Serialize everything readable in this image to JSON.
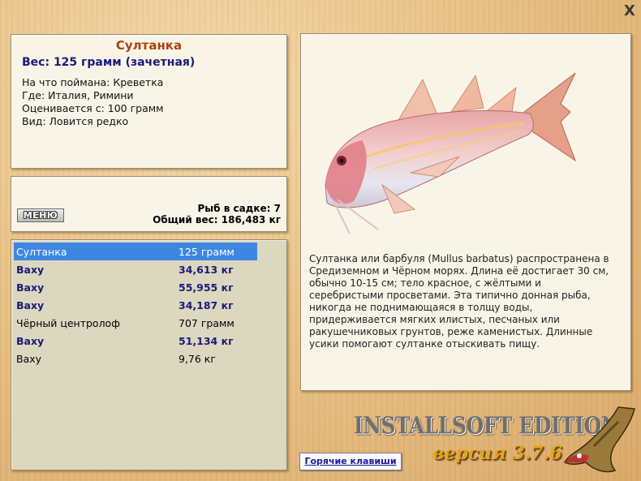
{
  "window": {
    "close_label": "X"
  },
  "info": {
    "name": "Султанка",
    "weight": "Вес: 125 грамм (зачетная)",
    "bait": "На что поймана: Креветка",
    "place": "Где: Италия, Римини",
    "valued": "Оценивается с: 100 грамм",
    "kind": "Вид: Ловится редко"
  },
  "stats": {
    "menu_label": "МЕНЮ",
    "fish_count": "Рыб в садке: 7",
    "total_weight": "Общий вес: 186,483 кг"
  },
  "catch_list": [
    {
      "name": "Султанка",
      "weight": "125 грамм",
      "style": "selected"
    },
    {
      "name": "Ваху",
      "weight": "34,613 кг",
      "style": "bold"
    },
    {
      "name": "Ваху",
      "weight": "55,955 кг",
      "style": "bold"
    },
    {
      "name": "Ваху",
      "weight": "34,187 кг",
      "style": "bold"
    },
    {
      "name": "Чёрный центролоф",
      "weight": "707 грамм",
      "style": "normal"
    },
    {
      "name": "Ваху",
      "weight": "51,134 кг",
      "style": "bold"
    },
    {
      "name": "Ваху",
      "weight": "9,76 кг",
      "style": "normal"
    }
  ],
  "description": "Султанка или барбуля (Mullus barbatus) распространена в Средиземном и Чёрном морях. Длина её достигает 30 см, обычно 10-15 см; тело красное, с жёлтыми и серебристыми просветами. Эта типично донная рыба, никогда не поднимающаяся в толщу воды, придерживается мягких илистых, песчаных или ракушечниковых грунтов, реже каменистых. Длинные усики помогают султанке отыскивать пищу.",
  "hotkeys_label": "Горячие клавиши",
  "logo": {
    "title": "INSTALLSOFT EDITION",
    "version": "версия 3.7.6"
  },
  "colors": {
    "fish_name": "#b0400e",
    "highlight_text": "#1a1a7a",
    "selection": "#3d87e0",
    "version": "#e2a51e"
  }
}
